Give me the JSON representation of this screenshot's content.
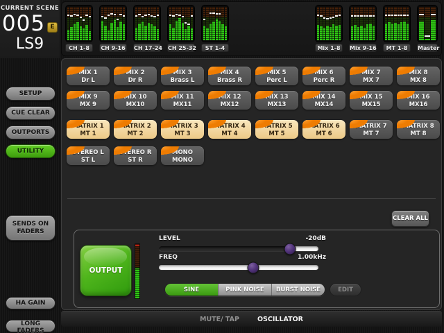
{
  "scene": {
    "label": "CURRENT SCENE",
    "number": "005",
    "edit_badge": "E",
    "console": "LS9"
  },
  "meter_bridge": {
    "left_blocks": [
      {
        "label": "CH 1-8",
        "narrow": false,
        "levels": [
          0.32,
          0.4,
          0.5,
          0.55,
          0.42,
          0.36,
          0.46,
          0.28
        ],
        "markers": [
          0.73,
          0.7,
          0.74,
          0.72,
          0.66,
          0.58,
          0.72,
          0.68
        ]
      },
      {
        "label": "CH 9-16",
        "narrow": false,
        "levels": [
          0.58,
          0.44,
          0.3,
          0.52,
          0.62,
          0.4,
          0.56,
          0.48
        ],
        "markers": [
          0.68,
          0.64,
          0.72,
          0.78,
          0.75,
          0.6,
          0.74,
          0.71
        ]
      },
      {
        "label": "CH 17-24",
        "narrow": false,
        "levels": [
          0.38,
          0.5,
          0.56,
          0.44,
          0.53,
          0.47,
          0.41,
          0.33
        ],
        "markers": [
          0.71,
          0.74,
          0.69,
          0.73,
          0.75,
          0.7,
          0.68,
          0.72
        ]
      },
      {
        "label": "CH 25-32",
        "narrow": false,
        "levels": [
          0.48,
          0.38,
          0.58,
          0.66,
          0.52,
          0.33,
          0.43,
          0.36
        ],
        "markers": [
          0.73,
          0.71,
          0.75,
          0.72,
          0.69,
          0.5,
          0.46,
          0.7
        ]
      },
      {
        "label": "ST 1-4",
        "narrow": false,
        "levels": [
          0.44,
          0.36,
          0.5,
          0.56,
          0.64,
          0.58,
          0.48,
          0.42
        ],
        "markers": [
          0.6,
          null,
          0.79,
          0.79,
          0.77,
          0.77,
          null,
          null
        ]
      }
    ],
    "right_blocks": [
      {
        "label": "Mix 1-8",
        "narrow": false,
        "levels": [
          0.46,
          0.41,
          0.37,
          0.44,
          0.39,
          0.47,
          0.43,
          0.45
        ],
        "markers": [
          0.72,
          0.7,
          0.65,
          0.62,
          0.64,
          0.67,
          0.71,
          0.72
        ]
      },
      {
        "label": "Mix 9-16",
        "narrow": false,
        "levels": [
          0.41,
          0.45,
          0.39,
          0.43,
          0.37,
          0.47,
          0.51,
          0.44
        ],
        "markers": [
          0.71,
          0.71,
          0.71,
          0.71,
          0.71,
          0.71,
          0.71,
          0.71
        ]
      },
      {
        "label": "MT 1-8",
        "narrow": false,
        "levels": [
          0.51,
          0.54,
          0.49,
          0.52,
          0.47,
          0.54,
          0.57,
          0.51
        ],
        "markers": [
          0.73,
          0.73,
          0.73,
          0.73,
          0.73,
          0.73,
          0.73,
          0.73
        ]
      },
      {
        "label": "Master",
        "narrow": true,
        "levels": [
          0.56,
          0.05,
          0.6
        ],
        "markers": [
          0.75,
          0.1,
          0.75
        ]
      }
    ]
  },
  "sidebar": {
    "items": [
      {
        "id": "setup",
        "label": "SETUP",
        "active": false
      },
      {
        "id": "cue-clear",
        "label": "CUE CLEAR",
        "active": false
      },
      {
        "id": "outports",
        "label": "OUTPORTS",
        "active": false
      },
      {
        "id": "utility",
        "label": "UTILITY",
        "active": true
      },
      {
        "id": "sends-on-faders",
        "label": "SENDS ON FADERS",
        "active": false
      },
      {
        "id": "ha-gain",
        "label": "HA GAIN",
        "active": false
      },
      {
        "id": "long-faders",
        "label": "LONG FADERS",
        "active": false
      }
    ]
  },
  "channel_grid": {
    "rows": [
      {
        "buttons": [
          {
            "line1": "MIX 1",
            "line2": "Dr L",
            "selected": false
          },
          {
            "line1": "MIX 2",
            "line2": "Dr R",
            "selected": false
          },
          {
            "line1": "MIX 3",
            "line2": "Brass L",
            "selected": false
          },
          {
            "line1": "MIX 4",
            "line2": "Brass R",
            "selected": false
          },
          {
            "line1": "MIX 5",
            "line2": "Perc L",
            "selected": false
          },
          {
            "line1": "MIX 6",
            "line2": "Perc R",
            "selected": false
          },
          {
            "line1": "MIX 7",
            "line2": "MX 7",
            "selected": false
          },
          {
            "line1": "MIX 8",
            "line2": "MX 8",
            "selected": false
          }
        ]
      },
      {
        "buttons": [
          {
            "line1": "MIX 9",
            "line2": "MX 9",
            "selected": false
          },
          {
            "line1": "MIX 10",
            "line2": "MX10",
            "selected": false
          },
          {
            "line1": "MIX 11",
            "line2": "MX11",
            "selected": false
          },
          {
            "line1": "MIX 12",
            "line2": "MX12",
            "selected": false
          },
          {
            "line1": "MIX 13",
            "line2": "MX13",
            "selected": false
          },
          {
            "line1": "MIX 14",
            "line2": "MX14",
            "selected": false
          },
          {
            "line1": "MIX 15",
            "line2": "MX15",
            "selected": false
          },
          {
            "line1": "MIX 16",
            "line2": "MX16",
            "selected": false
          }
        ]
      },
      {
        "buttons": [
          {
            "line1": "MATRIX 1",
            "line2": "MT 1",
            "selected": true
          },
          {
            "line1": "MATRIX 2",
            "line2": "MT 2",
            "selected": true
          },
          {
            "line1": "MATRIX 3",
            "line2": "MT 3",
            "selected": true
          },
          {
            "line1": "MATRIX 4",
            "line2": "MT 4",
            "selected": true
          },
          {
            "line1": "MATRIX 5",
            "line2": "MT 5",
            "selected": true
          },
          {
            "line1": "MATRIX 6",
            "line2": "MT 6",
            "selected": true
          },
          {
            "line1": "MATRIX 7",
            "line2": "MT 7",
            "selected": false
          },
          {
            "line1": "MATRIX 8",
            "line2": "MT 8",
            "selected": false
          }
        ]
      },
      {
        "buttons": [
          {
            "line1": "STEREO L",
            "line2": "ST L",
            "selected": false
          },
          {
            "line1": "STEREO R",
            "line2": "ST R",
            "selected": false
          },
          {
            "line1": "MONO",
            "line2": "MONO",
            "selected": false
          }
        ]
      }
    ]
  },
  "clear_all_label": "CLEAR ALL",
  "oscillator": {
    "output_label": "OUTPUT",
    "output_meter_level_percent": 55,
    "level": {
      "label": "LEVEL",
      "value": "-20dB",
      "thumb_percent": 82,
      "fill_percent": 82
    },
    "freq": {
      "label": "FREQ",
      "value": "1.00kHz",
      "thumb_percent": 59,
      "fill_percent": 0
    },
    "waveforms": [
      {
        "label": "SINE",
        "active": true
      },
      {
        "label": "PINK NOISE",
        "active": false
      },
      {
        "label": "BURST NOISE",
        "active": false
      }
    ],
    "edit_label": "EDIT"
  },
  "bottom_bar": {
    "tabs": [
      {
        "label": "MUTE/ TAP",
        "active": false
      },
      {
        "label": "OSCILLATOR",
        "active": true
      }
    ]
  },
  "colors": {
    "accent_orange": "#ee7c02",
    "active_green": "#4bae19",
    "selected_cream": "#f2d9a2",
    "meter_green": "#2fc714",
    "slider_thumb_purple": "#53357c",
    "edit_badge_gold": "#c9a227"
  }
}
